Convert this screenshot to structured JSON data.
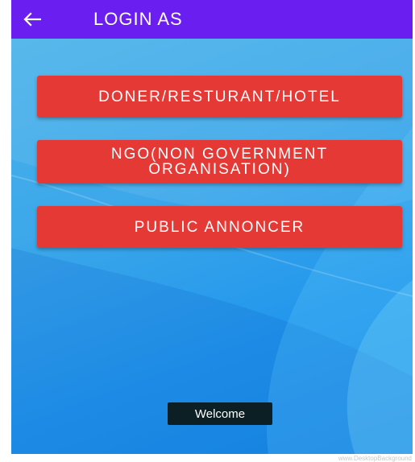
{
  "app_bar": {
    "title": "LOGIN AS",
    "back_icon": "arrow-left-icon",
    "color": "#6a1ff0"
  },
  "buttons": {
    "donor_label": "DONER/RESTURANT/HOTEL",
    "ngo_label": "NGO(NON GOVERNMENT ORGANISATION)",
    "public_label": "PUBLIC ANNONCER",
    "color": "#e53935"
  },
  "toast": {
    "text": "Welcome"
  },
  "background": {
    "accent": "#2196ec"
  },
  "watermark": {
    "text": "www.DesktopBackground"
  }
}
